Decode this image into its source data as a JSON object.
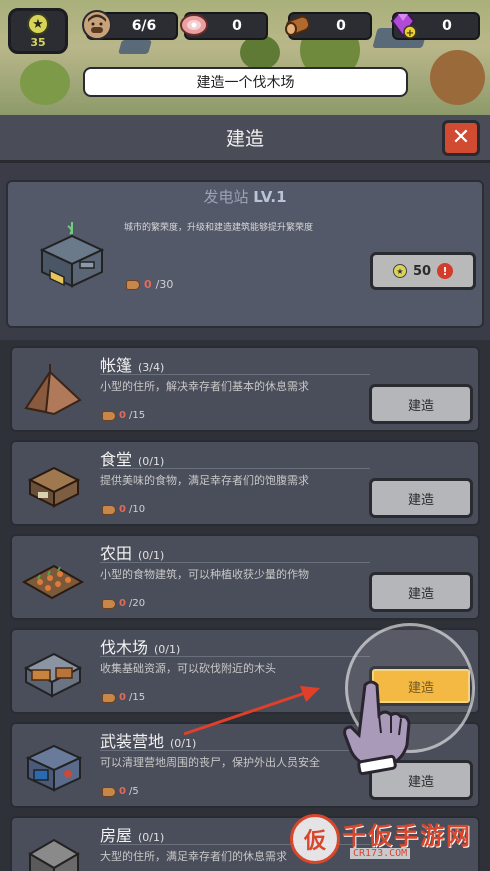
{
  "hud": {
    "level": "35",
    "survivors": "6/6",
    "meat": "0",
    "wood": "0",
    "gems": "0"
  },
  "tip": "建造一个伐木场",
  "panel": {
    "title": "建造",
    "close": "✕"
  },
  "featured": {
    "name": "发电站",
    "level": "LV.1",
    "description": "城市的繁荣度，升级和建造建筑能够提升繁荣度",
    "cost_have": "0",
    "cost_total": "/30",
    "button_value": "50",
    "alert": "!"
  },
  "buildings": [
    {
      "name": "帐篷",
      "count": "(3/4)",
      "description": "小型的住所，解决幸存者们基本的休息需求",
      "cost_have": "0",
      "cost_total": "/15",
      "button": "建造"
    },
    {
      "name": "食堂",
      "count": "(0/1)",
      "description": "提供美味的食物，满足幸存者们的饱腹需求",
      "cost_have": "0",
      "cost_total": "/10",
      "button": "建造"
    },
    {
      "name": "农田",
      "count": "(0/1)",
      "description": "小型的食物建筑，可以种植收获少量的作物",
      "cost_have": "0",
      "cost_total": "/20",
      "button": "建造"
    },
    {
      "name": "伐木场",
      "count": "(0/1)",
      "description": "收集基础资源，可以砍伐附近的木头",
      "cost_have": "0",
      "cost_total": "/15",
      "button": "建造"
    },
    {
      "name": "武装营地",
      "count": "(0/1)",
      "description": "可以清理营地周围的丧尸，保护外出人员安全",
      "cost_have": "0",
      "cost_total": "/5",
      "button": "建造"
    },
    {
      "name": "房屋",
      "count": "(0/1)",
      "description": "大型的住所，满足幸存者们的休息需求",
      "cost_have": "",
      "cost_total": "",
      "button": ""
    }
  ],
  "watermark": {
    "logo": "仮",
    "text": "千仮手游网",
    "url": "CR173.COM"
  },
  "colors": {
    "accent_button": "#f2b434",
    "close_button": "#d14a32",
    "level_star": "#d7d45a",
    "cost_shortfall": "#e36a5a"
  },
  "icons": {
    "level": "star-icon",
    "survivors": "survivor-portrait-icon",
    "meat": "meat-icon",
    "wood": "wood-log-icon",
    "gems": "purple-gem-icon",
    "cost": "wood-log-icon"
  }
}
